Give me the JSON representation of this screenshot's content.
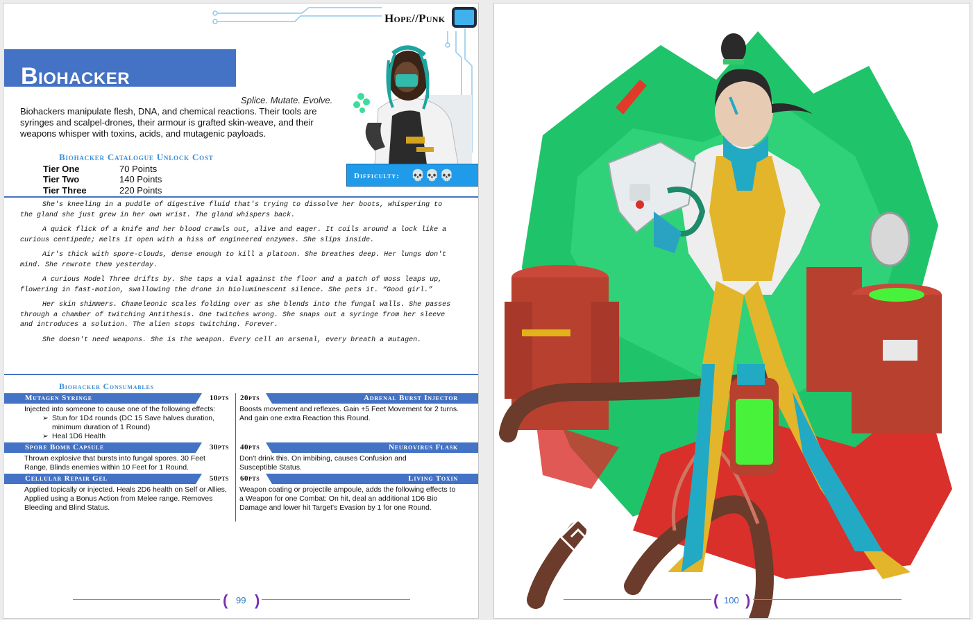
{
  "left_page": {
    "brand": "Hope//Punk",
    "title": "Biohacker",
    "tagline": "Splice. Mutate. Evolve.",
    "intro": "Biohackers manipulate flesh, DNA, and chemical reactions. Their tools are syringes and scalpel-drones, their armour is grafted skin-weave, and their weapons whisper with toxins, acids, and mutagenic payloads.",
    "catalogue": {
      "heading": "Biohacker Catalogue Unlock Cost",
      "tiers": [
        {
          "name": "Tier One",
          "cost": "70 Points"
        },
        {
          "name": "Tier Two",
          "cost": "140 Points"
        },
        {
          "name": "Tier Three",
          "cost": "220 Points"
        }
      ]
    },
    "difficulty": {
      "label": "Difficulty:",
      "icons": "💀💀💀",
      "level": 3
    },
    "story": [
      "She's kneeling in a puddle of digestive fluid that's trying to dissolve her boots, whispering to the gland she just grew in her own wrist. The gland whispers back.",
      "A quick flick of a knife and her blood crawls out, alive and eager. It coils around a lock like a curious centipede; melts it open with a hiss of engineered enzymes. She slips inside.",
      "Air's thick with spore-clouds, dense enough to kill a platoon. She breathes deep. Her lungs don't mind. She rewrote them yesterday.",
      "A curious Model Three drifts by. She taps a vial against the floor and a patch of moss leaps up, flowering in fast-motion, swallowing the drone in bioluminescent silence. She pets it. “Good girl.”",
      "Her skin shimmers. Chameleonic scales folding over as she blends into the fungal walls. She passes through a chamber of twitching Antithesis. One twitches wrong. She snaps out a syringe from her sleeve and introduces a solution. The alien stops twitching. Forever.",
      "She doesn't need weapons. She is the weapon. Every cell an arsenal, every breath a mutagen."
    ],
    "consumables": {
      "heading": "Biohacker Consumables",
      "items": [
        {
          "name": "Mutagen Syringe",
          "pts": "10pts",
          "desc": "Injected into someone to cause one of the following effects:",
          "bullets": [
            "Stun for 1D4 rounds (DC 15 Save halves duration, minimum duration of 1 Round)",
            "Heal 1D6 Health"
          ]
        },
        {
          "name": "Adrenal Burst Injector",
          "pts": "20pts",
          "desc": "Boosts movement and reflexes. Gain +5 Feet Movement for 2 turns. And gain one extra Reaction this Round."
        },
        {
          "name": "Spore Bomb Capsule",
          "pts": "30pts",
          "desc": "Thrown explosive that bursts into fungal spores. 30 Feet Range, Blinds enemies within 10 Feet for 1 Round."
        },
        {
          "name": "Neurovirus Flask",
          "pts": "40pts",
          "desc": "Don't drink this. On imbibing, causes Confusion and Susceptible Status."
        },
        {
          "name": "Cellular Repair Gel",
          "pts": "50pts",
          "desc": "Applied topically or injected. Heals 2D6 health on Self or Allies, Applied using a Bonus Action from Melee range. Removes Bleeding and Blind Status."
        },
        {
          "name": "Living Toxin",
          "pts": "60pts",
          "desc": "Weapon coating or projectile ampoule, adds the following effects to a Weapon for one Combat: On hit, deal an additional 1D6 Bio Damage and lower hit Target's Evasion by 1 for one Round."
        }
      ]
    },
    "page_number": "99",
    "bracket_open": "(",
    "bracket_close": ")",
    "bullet_arrow": "➢"
  },
  "right_page": {
    "page_number": "100",
    "illustration": "biohacker-character-art",
    "colors": {
      "splash_green": "#1fc46a",
      "splash_red": "#d9302b",
      "suit_yellow": "#e3b52a",
      "suit_teal": "#22a9c4",
      "canister_red": "#b8402f",
      "toxin_green": "#49f23a"
    }
  },
  "colors": {
    "banner_blue": "#4472c4",
    "heading_blue": "#3a8ed8",
    "difficulty_blue": "#1f9be9",
    "page_num_bracket": "#7a2fb3"
  }
}
